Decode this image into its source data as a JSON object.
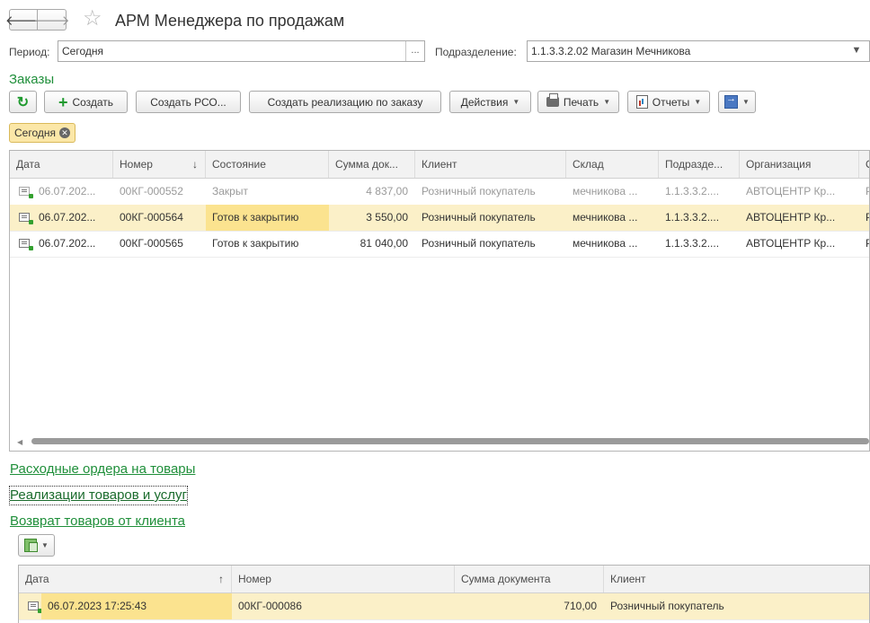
{
  "header": {
    "title": "АРМ Менеджера по продажам",
    "back_icon": "arrow-left-icon",
    "forward_icon": "arrow-right-icon",
    "favorite_icon": "star-icon"
  },
  "filters": {
    "period_label": "Период:",
    "period_value": "Сегодня",
    "period_button": "...",
    "division_label": "Подразделение:",
    "division_value": "1.1.3.3.2.02 Магазин Мечникова"
  },
  "orders": {
    "title": "Заказы",
    "toolbar": {
      "create": "Создать",
      "create_rso": "Создать РСО...",
      "create_sale": "Создать реализацию по заказу",
      "actions": "Действия",
      "print": "Печать",
      "reports": "Отчеты"
    },
    "chip": "Сегодня",
    "columns": [
      "Дата",
      "Номер",
      "Состояние",
      "Сумма док...",
      "Клиент",
      "Склад",
      "Подразде...",
      "Организация",
      "О"
    ],
    "rows": [
      [
        "06.07.202...",
        "00КГ-000552",
        "Закрыт",
        "4 837,00",
        "Розничный покупатель",
        "мечникова ...",
        "1.1.3.3.2....",
        "АВТОЦЕНТР Кр...",
        "Р"
      ],
      [
        "06.07.202...",
        "00КГ-000564",
        "Готов к закрытию",
        "3 550,00",
        "Розничный покупатель",
        "мечникова ...",
        "1.1.3.3.2....",
        "АВТОЦЕНТР Кр...",
        "Р"
      ],
      [
        "06.07.202...",
        "00КГ-000565",
        "Готов к закрытию",
        "81 040,00",
        "Розничный покупатель",
        "мечникова ...",
        "1.1.3.3.2....",
        "АВТОЦЕНТР Кр...",
        "Р"
      ]
    ]
  },
  "sections": {
    "outgoing_orders": "Расходные ордера на товары",
    "sales": "Реализации товаров и услуг",
    "returns": "Возврат товаров от клиента"
  },
  "returns_table": {
    "columns": [
      "Дата",
      "Номер",
      "Сумма документа",
      "Клиент"
    ],
    "rows": [
      [
        "06.07.2023 17:25:43",
        "00КГ-000086",
        "710,00",
        "Розничный покупатель"
      ]
    ]
  },
  "colors": {
    "accent_green": "#1f8f3a",
    "selected_row": "#fbf0c8",
    "highlight_cell": "#fbe38f"
  }
}
